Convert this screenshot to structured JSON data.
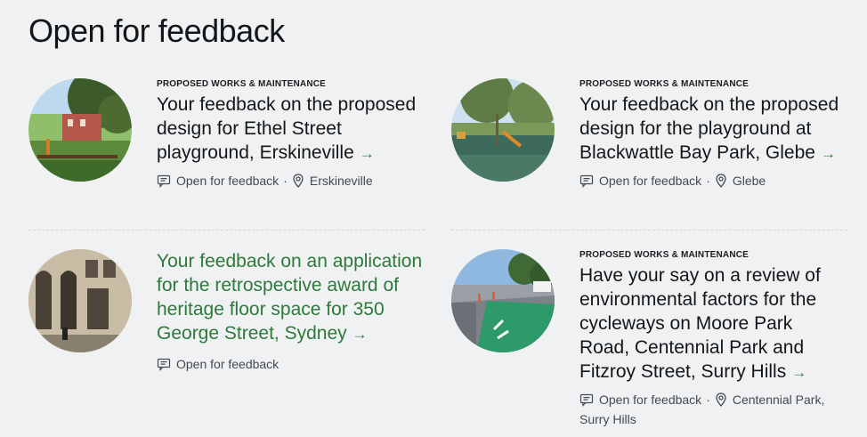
{
  "page": {
    "title": "Open for feedback"
  },
  "cards": [
    {
      "category": "Proposed works & maintenance",
      "title": "Your feedback on the proposed design for Ethel Street playground, Erskineville",
      "status": "Open for feedback",
      "location": "Erskineville"
    },
    {
      "category": "Proposed works & maintenance",
      "title": "Your feedback on the proposed design for the playground at Blackwattle Bay Park, Glebe",
      "status": "Open for feedback",
      "location": "Glebe"
    },
    {
      "category": "",
      "title": "Your feedback on an application for the retrospective award of heritage floor space for 350 George Street, Sydney",
      "status": "Open for feedback",
      "location": ""
    },
    {
      "category": "Proposed works & maintenance",
      "title": "Have your say on a review of environmental factors for the cycleways on Moore Park Road, Centennial Park and Fitzroy Street, Surry Hills",
      "status": "Open for feedback",
      "location": "Centennial Park, Surry Hills"
    }
  ],
  "icons": {
    "comment": "comment-icon",
    "location": "location-pin-icon",
    "arrow": "arrow-right-icon"
  },
  "colors": {
    "background": "#f0f1f2",
    "visited_link": "#2d7a3a",
    "arrow": "#2d7a3a"
  }
}
